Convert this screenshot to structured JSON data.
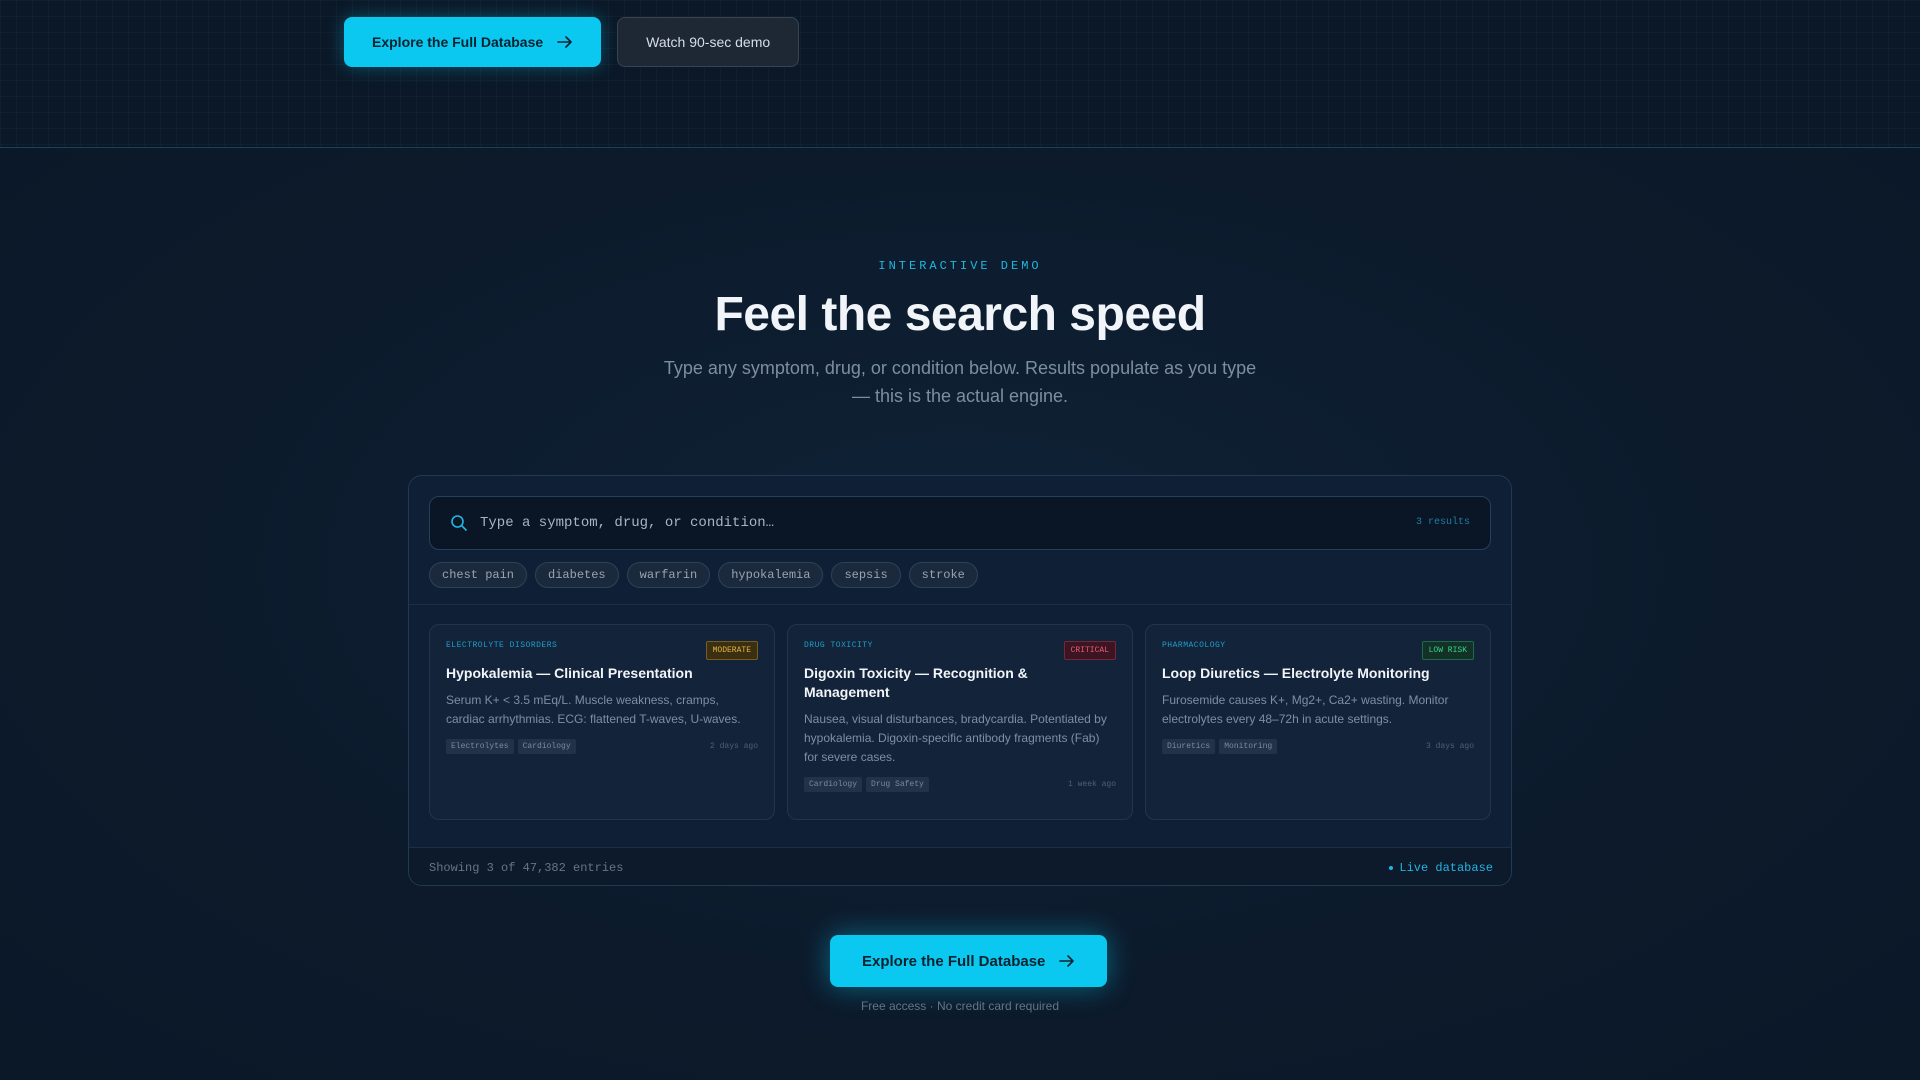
{
  "hero_actions": {
    "primary_label": "Explore the Full Database",
    "secondary_label": "Watch 90-sec demo"
  },
  "demo": {
    "eyebrow": "INTERACTIVE DEMO",
    "title": "Feel the search speed",
    "subtitle": "Type any symptom, drug, or condition below. Results populate as you type — this is the actual engine.",
    "search": {
      "placeholder": "Type a symptom, drug, or condition…",
      "value": "",
      "result_count": "3 results"
    },
    "chips": [
      "chest pain",
      "diabetes",
      "warfarin",
      "hypokalemia",
      "sepsis",
      "stroke"
    ],
    "cards": [
      {
        "category": "ELECTROLYTE DISORDERS",
        "badge": "MODERATE",
        "title": "Hypokalemia — Clinical Presentation",
        "description": "Serum K+ < 3.5 mEq/L. Muscle weakness, cramps, cardiac arrhythmias. ECG: flattened T-waves, U-waves.",
        "tags": [
          "Electrolytes",
          "Cardiology"
        ],
        "time": "2 days ago"
      },
      {
        "category": "DRUG TOXICITY",
        "badge": "CRITICAL",
        "title": "Digoxin Toxicity — Recognition & Management",
        "description": "Nausea, visual disturbances, bradycardia. Potentiated by hypokalemia. Digoxin-specific antibody fragments (Fab) for severe cases.",
        "tags": [
          "Cardiology",
          "Drug Safety"
        ],
        "time": "1 week ago"
      },
      {
        "category": "PHARMACOLOGY",
        "badge": "LOW RISK",
        "title": "Loop Diuretics — Electrolyte Monitoring",
        "description": "Furosemide causes K+, Mg2+, Ca2+ wasting. Monitor electrolytes every 48–72h in acute settings.",
        "tags": [
          "Diuretics",
          "Monitoring"
        ],
        "time": "3 days ago"
      }
    ],
    "footer": {
      "showing": "Showing 3 of 47,382 entries",
      "live": "Live database"
    }
  },
  "cta": {
    "label": "Explore the Full Database",
    "note": "Free access · No credit card required"
  },
  "colors": {
    "accent": "#0bc8f0",
    "background": "#0c1a2b",
    "moderate": "#e8b33b",
    "critical": "#ef5a78",
    "low_risk": "#3bd48b"
  }
}
